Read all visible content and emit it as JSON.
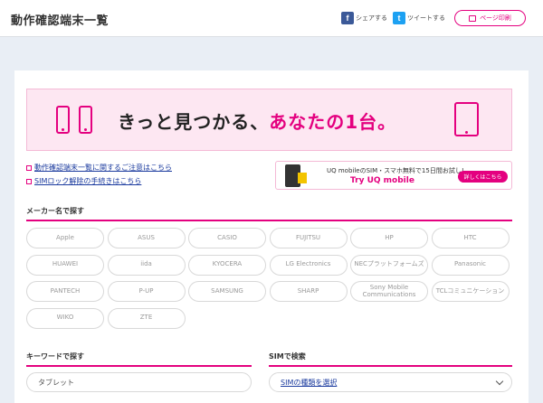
{
  "header": {
    "title": "動作確認端末一覧",
    "share_fb": "シェアする",
    "share_tw": "ツイートする",
    "print": "ページ印刷"
  },
  "banner": {
    "text_main": "きっと見つかる、",
    "text_highlight": "あなたの1台。"
  },
  "links": {
    "notice": "動作確認端末一覧に関するご注意はこちら",
    "sim_unlock": "SIMロック解除の手続きはこちら"
  },
  "uq_banner": {
    "line1": "UQ mobileのSIM・スマホ無料で15日間お試し!",
    "line2": "Try UQ mobile",
    "button": "詳しくはこちら"
  },
  "maker_section": {
    "title": "メーカー名で探す",
    "makers": [
      "Apple",
      "ASUS",
      "CASIO",
      "FUJITSU",
      "HP",
      "HTC",
      "HUAWEI",
      "iida",
      "KYOCERA",
      "LG Electronics",
      "NECプラットフォームズ",
      "Panasonic",
      "PANTECH",
      "P-UP",
      "SAMSUNG",
      "SHARP",
      "Sony Mobile Communications",
      "TCLコミュニケーション",
      "WIKO",
      "ZTE"
    ]
  },
  "keyword_section": {
    "title": "キーワードで探す",
    "value": "タブレット"
  },
  "sim_section": {
    "title": "SIMで検索",
    "select_label": "SIMの種類を選択"
  },
  "colors": {
    "accent": "#e4007f",
    "link": "#1a3a9e",
    "background": "#e9eef5"
  }
}
